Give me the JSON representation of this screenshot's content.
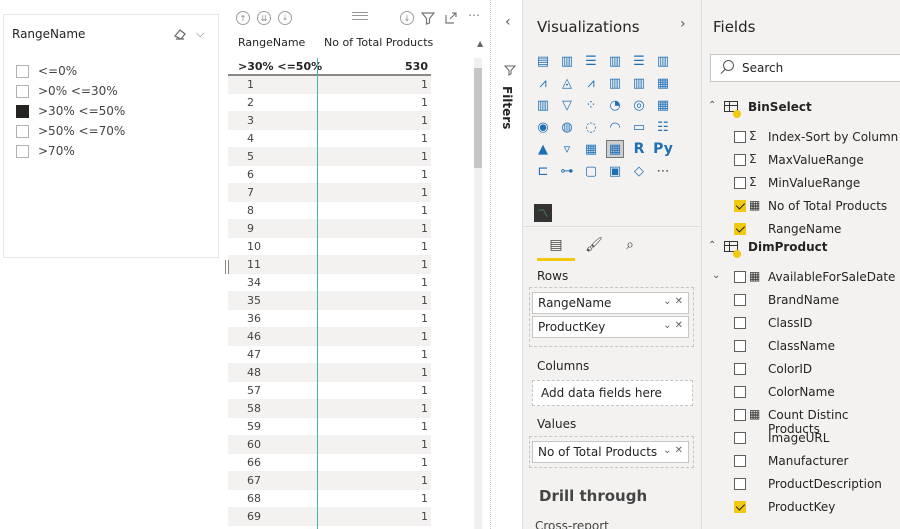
{
  "slicer": {
    "title": "RangeName",
    "items": [
      {
        "label": "<=0%",
        "checked": false
      },
      {
        "label": ">0% <=30%",
        "checked": false
      },
      {
        "label": ">30% <=50%",
        "checked": true
      },
      {
        "label": ">50% <=70%",
        "checked": false
      },
      {
        "label": ">70%",
        "checked": false
      }
    ]
  },
  "table": {
    "col1": "RangeName",
    "col2": "No of Total Products",
    "total": {
      "range": ">30% <=50%",
      "count": "530"
    },
    "rows": [
      {
        "key": "1",
        "val": "1"
      },
      {
        "key": "2",
        "val": "1"
      },
      {
        "key": "3",
        "val": "1"
      },
      {
        "key": "4",
        "val": "1"
      },
      {
        "key": "5",
        "val": "1"
      },
      {
        "key": "6",
        "val": "1"
      },
      {
        "key": "7",
        "val": "1"
      },
      {
        "key": "8",
        "val": "1"
      },
      {
        "key": "9",
        "val": "1"
      },
      {
        "key": "10",
        "val": "1"
      },
      {
        "key": "11",
        "val": "1"
      },
      {
        "key": "34",
        "val": "1"
      },
      {
        "key": "35",
        "val": "1"
      },
      {
        "key": "36",
        "val": "1"
      },
      {
        "key": "46",
        "val": "1"
      },
      {
        "key": "47",
        "val": "1"
      },
      {
        "key": "48",
        "val": "1"
      },
      {
        "key": "57",
        "val": "1"
      },
      {
        "key": "58",
        "val": "1"
      },
      {
        "key": "59",
        "val": "1"
      },
      {
        "key": "60",
        "val": "1"
      },
      {
        "key": "66",
        "val": "1"
      },
      {
        "key": "67",
        "val": "1"
      },
      {
        "key": "68",
        "val": "1"
      },
      {
        "key": "69",
        "val": "1"
      }
    ]
  },
  "filters": {
    "label": "Filters"
  },
  "visualizations": {
    "title": "Visualizations",
    "rows_label": "Rows",
    "rows_fields": [
      "RangeName",
      "ProductKey"
    ],
    "columns_label": "Columns",
    "columns_placeholder": "Add data fields here",
    "values_label": "Values",
    "values_fields": [
      "No of Total Products"
    ],
    "drill_through": "Drill through",
    "cross_report": "Cross-report"
  },
  "fields": {
    "title": "Fields",
    "search_placeholder": "Search",
    "tables": [
      {
        "name": "BinSelect",
        "fields": [
          {
            "name": "Index-Sort by Column",
            "type": "Σ",
            "checked": false
          },
          {
            "name": "MaxValueRange",
            "type": "Σ",
            "checked": false
          },
          {
            "name": "MinValueRange",
            "type": "Σ",
            "checked": false
          },
          {
            "name": "No of Total Products",
            "type": "▦",
            "checked": true
          },
          {
            "name": "RangeName",
            "type": "",
            "checked": true
          }
        ]
      },
      {
        "name": "DimProduct",
        "fields": [
          {
            "name": "AvailableForSaleDate",
            "type": "▦",
            "checked": false,
            "expandable": true
          },
          {
            "name": "BrandName",
            "type": "",
            "checked": false
          },
          {
            "name": "ClassID",
            "type": "",
            "checked": false
          },
          {
            "name": "ClassName",
            "type": "",
            "checked": false
          },
          {
            "name": "ColorID",
            "type": "",
            "checked": false
          },
          {
            "name": "ColorName",
            "type": "",
            "checked": false
          },
          {
            "name": "Count Distinc Products",
            "type": "▦",
            "checked": false
          },
          {
            "name": "ImageURL",
            "type": "",
            "checked": false
          },
          {
            "name": "Manufacturer",
            "type": "",
            "checked": false
          },
          {
            "name": "ProductDescription",
            "type": "",
            "checked": false
          },
          {
            "name": "ProductKey",
            "type": "",
            "checked": true
          }
        ]
      }
    ]
  },
  "icons": {
    "more": "⋯",
    "r_visual": "R",
    "py_visual": "Py"
  }
}
